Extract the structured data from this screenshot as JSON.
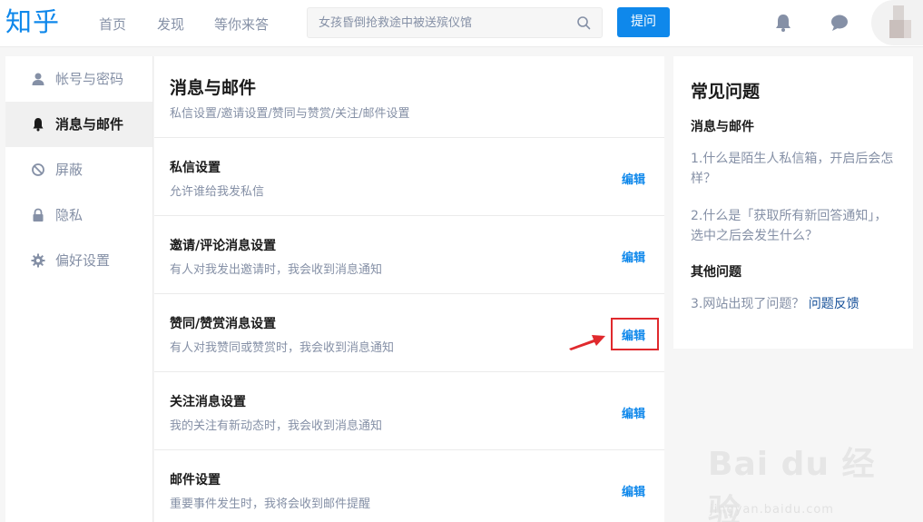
{
  "brand": {
    "logo": "知乎",
    "color": "#0f88eb"
  },
  "topnav": {
    "items": [
      "首页",
      "发现",
      "等你来答"
    ]
  },
  "search": {
    "placeholder": "女孩昏倒抢救途中被送殡仪馆",
    "icon": "search-icon"
  },
  "header_actions": {
    "ask_label": "提问",
    "bell_icon": "bell-icon",
    "chat_icon": "chat-bubble-icon"
  },
  "sidebar": {
    "items": [
      {
        "label": "帐号与密码",
        "icon": "user-icon",
        "active": false
      },
      {
        "label": "消息与邮件",
        "icon": "bell-icon",
        "active": true
      },
      {
        "label": "屏蔽",
        "icon": "block-icon",
        "active": false
      },
      {
        "label": "隐私",
        "icon": "lock-icon",
        "active": false
      },
      {
        "label": "偏好设置",
        "icon": "gear-icon",
        "active": false
      }
    ]
  },
  "main": {
    "title": "消息与邮件",
    "subtitle": "私信设置/邀请设置/赞同与赞赏/关注/邮件设置",
    "rows": [
      {
        "title": "私信设置",
        "desc": "允许谁给我发私信",
        "edit": "编辑"
      },
      {
        "title": "邀请/评论消息设置",
        "desc": "有人对我发出邀请时，我会收到消息通知",
        "edit": "编辑"
      },
      {
        "title": "赞同/赞赏消息设置",
        "desc": "有人对我赞同或赞赏时，我会收到消息通知",
        "edit": "编辑"
      },
      {
        "title": "关注消息设置",
        "desc": "我的关注有新动态时，我会收到消息通知",
        "edit": "编辑"
      },
      {
        "title": "邮件设置",
        "desc": "重要事件发生时，我将会收到邮件提醒",
        "edit": "编辑"
      }
    ]
  },
  "faq": {
    "title": "常见问题",
    "section1": "消息与邮件",
    "q1": "1.什么是陌生人私信箱，开启后会怎样？",
    "q2": "2.什么是「获取所有新回答通知」，选中之后会发生什么？",
    "section2": "其他问题",
    "q3": "3.网站出现了问题？",
    "q3_link": "问题反馈"
  },
  "annotation": {
    "color": "#e0292d"
  },
  "watermark": {
    "text": "Bai du 经验",
    "sub": "jingyan.baidu.com"
  }
}
